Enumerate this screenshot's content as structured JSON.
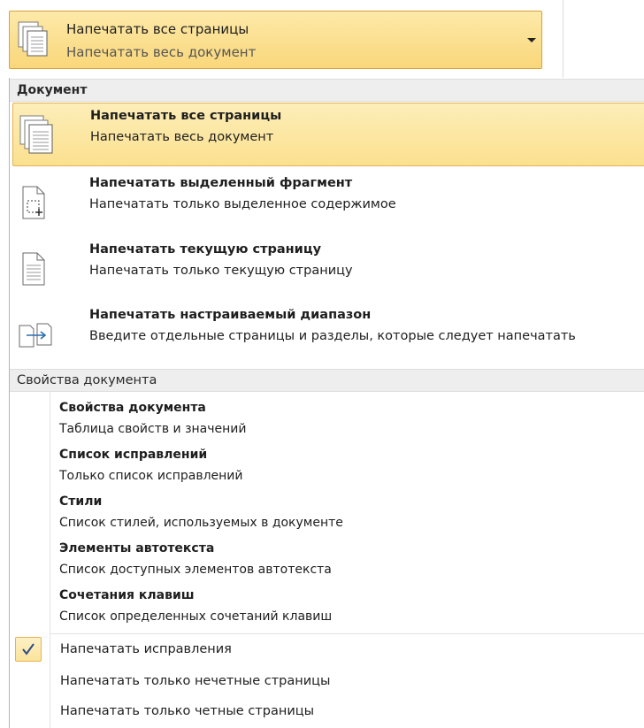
{
  "dropdown": {
    "title": "Напечатать все страницы",
    "subtitle": "Напечатать весь документ",
    "icon": "print-all-pages-icon"
  },
  "sections": {
    "document": "Документ",
    "properties": "Свойства документа"
  },
  "print_items": [
    {
      "title": "Напечатать все страницы",
      "desc": "Напечатать весь документ",
      "icon": "print-all-pages-icon",
      "selected": true
    },
    {
      "title": "Напечатать выделенный фрагмент",
      "desc": "Напечатать только выделенное содержимое",
      "icon": "print-selection-icon",
      "selected": false
    },
    {
      "title": "Напечатать текущую страницу",
      "desc": "Напечатать только текущую страницу",
      "icon": "print-current-page-icon",
      "selected": false
    },
    {
      "title": "Напечатать настраиваемый диапазон",
      "desc": "Введите отдельные страницы и разделы, которые следует напечатать",
      "icon": "print-custom-range-icon",
      "selected": false
    }
  ],
  "property_items": [
    {
      "title": "Свойства документа",
      "desc": "Таблица свойств и значений"
    },
    {
      "title": "Список исправлений",
      "desc": "Только список исправлений"
    },
    {
      "title": "Стили",
      "desc": "Список стилей, используемых в документе"
    },
    {
      "title": "Элементы автотекста",
      "desc": "Список доступных элементов автотекста"
    },
    {
      "title": "Сочетания клавиш",
      "desc": "Список определенных сочетаний клавиш"
    }
  ],
  "options": [
    {
      "label": "Напечатать исправления",
      "checked": true
    },
    {
      "label": "Напечатать только нечетные страницы",
      "checked": false
    },
    {
      "label": "Напечатать только четные страницы",
      "checked": false
    }
  ],
  "colors": {
    "highlight": "#fbe08f",
    "highlight_border": "#e5b254",
    "header_bg": "#eeeeee"
  }
}
